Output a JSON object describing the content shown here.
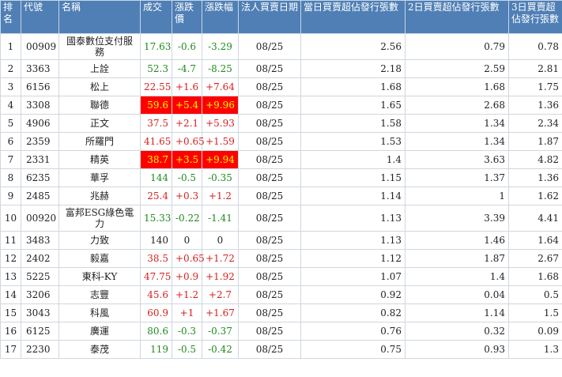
{
  "headers": {
    "rank": "排名",
    "code": "代號",
    "name": "名稱",
    "price": "成交",
    "change": "漲跌價",
    "pct": "漲跌幅",
    "date": "法人買賣日期",
    "d1": "當日買賣超佔發行張數",
    "d2": "2日買賣超佔發行張數",
    "d3": "3日買賣超佔發行張數"
  },
  "colors": {
    "header_bg": "#4f7fb5",
    "up": "#d62020",
    "down": "#1e8a1e",
    "highlight_bg": "#ff0000",
    "highlight_fg": "#ffff00"
  },
  "rows": [
    {
      "rank": "1",
      "code": "00909",
      "name": "國泰數位支付服務",
      "price": "17.63",
      "change": "-0.6",
      "pct": "-3.29",
      "date": "08/25",
      "d1": "2.56",
      "d2": "0.79",
      "d3": "0.78",
      "dir": "down",
      "tall": true,
      "hl": false
    },
    {
      "rank": "2",
      "code": "3363",
      "name": "上詮",
      "price": "52.3",
      "change": "-4.7",
      "pct": "-8.25",
      "date": "08/25",
      "d1": "2.18",
      "d2": "2.59",
      "d3": "2.81",
      "dir": "down",
      "tall": false,
      "hl": false
    },
    {
      "rank": "3",
      "code": "6156",
      "name": "松上",
      "price": "22.55",
      "change": "+1.6",
      "pct": "+7.64",
      "date": "08/25",
      "d1": "1.68",
      "d2": "1.68",
      "d3": "1.75",
      "dir": "up",
      "tall": false,
      "hl": false
    },
    {
      "rank": "4",
      "code": "3308",
      "name": "聯德",
      "price": "59.6",
      "change": "+5.4",
      "pct": "+9.96",
      "date": "08/25",
      "d1": "1.65",
      "d2": "2.68",
      "d3": "1.36",
      "dir": "up",
      "tall": false,
      "hl": true
    },
    {
      "rank": "5",
      "code": "4906",
      "name": "正文",
      "price": "37.5",
      "change": "+2.1",
      "pct": "+5.93",
      "date": "08/25",
      "d1": "1.58",
      "d2": "1.34",
      "d3": "2.34",
      "dir": "up",
      "tall": false,
      "hl": false
    },
    {
      "rank": "6",
      "code": "2359",
      "name": "所羅門",
      "price": "41.65",
      "change": "+0.65",
      "pct": "+1.59",
      "date": "08/25",
      "d1": "1.53",
      "d2": "1.34",
      "d3": "1.87",
      "dir": "up",
      "tall": false,
      "hl": false
    },
    {
      "rank": "7",
      "code": "2331",
      "name": "精英",
      "price": "38.7",
      "change": "+3.5",
      "pct": "+9.94",
      "date": "08/25",
      "d1": "1.4",
      "d2": "3.63",
      "d3": "4.82",
      "dir": "up",
      "tall": false,
      "hl": true
    },
    {
      "rank": "8",
      "code": "6235",
      "name": "華孚",
      "price": "144",
      "change": "-0.5",
      "pct": "-0.35",
      "date": "08/25",
      "d1": "1.15",
      "d2": "1.37",
      "d3": "1.36",
      "dir": "down",
      "tall": false,
      "hl": false
    },
    {
      "rank": "9",
      "code": "2485",
      "name": "兆赫",
      "price": "25.4",
      "change": "+0.3",
      "pct": "+1.2",
      "date": "08/25",
      "d1": "1.14",
      "d2": "1",
      "d3": "1.62",
      "dir": "up",
      "tall": false,
      "hl": false
    },
    {
      "rank": "10",
      "code": "00920",
      "name": "富邦ESG綠色電力",
      "price": "15.33",
      "change": "-0.22",
      "pct": "-1.41",
      "date": "08/25",
      "d1": "1.13",
      "d2": "3.39",
      "d3": "4.41",
      "dir": "down",
      "tall": true,
      "hl": false
    },
    {
      "rank": "11",
      "code": "3483",
      "name": "力致",
      "price": "140",
      "change": "0",
      "pct": "0",
      "date": "08/25",
      "d1": "1.13",
      "d2": "1.46",
      "d3": "1.64",
      "dir": "flat",
      "tall": false,
      "hl": false
    },
    {
      "rank": "12",
      "code": "2402",
      "name": "毅嘉",
      "price": "38.5",
      "change": "+0.65",
      "pct": "+1.72",
      "date": "08/25",
      "d1": "1.12",
      "d2": "1.87",
      "d3": "2.67",
      "dir": "up",
      "tall": false,
      "hl": false
    },
    {
      "rank": "13",
      "code": "5225",
      "name": "東科-KY",
      "price": "47.75",
      "change": "+0.9",
      "pct": "+1.92",
      "date": "08/25",
      "d1": "1.07",
      "d2": "1.4",
      "d3": "1.68",
      "dir": "up",
      "tall": false,
      "hl": false
    },
    {
      "rank": "14",
      "code": "3206",
      "name": "志豐",
      "price": "45.6",
      "change": "+1.2",
      "pct": "+2.7",
      "date": "08/25",
      "d1": "0.92",
      "d2": "0.04",
      "d3": "0.5",
      "dir": "up",
      "tall": false,
      "hl": false
    },
    {
      "rank": "15",
      "code": "3043",
      "name": "科風",
      "price": "60.9",
      "change": "+1",
      "pct": "+1.67",
      "date": "08/25",
      "d1": "0.82",
      "d2": "1.14",
      "d3": "1.5",
      "dir": "up",
      "tall": false,
      "hl": false
    },
    {
      "rank": "16",
      "code": "6125",
      "name": "廣運",
      "price": "80.6",
      "change": "-0.3",
      "pct": "-0.37",
      "date": "08/25",
      "d1": "0.76",
      "d2": "0.32",
      "d3": "0.09",
      "dir": "down",
      "tall": false,
      "hl": false
    },
    {
      "rank": "17",
      "code": "2230",
      "name": "泰茂",
      "price": "119",
      "change": "-0.5",
      "pct": "-0.42",
      "date": "08/25",
      "d1": "0.75",
      "d2": "0.93",
      "d3": "1.3",
      "dir": "down",
      "tall": false,
      "hl": false
    }
  ]
}
